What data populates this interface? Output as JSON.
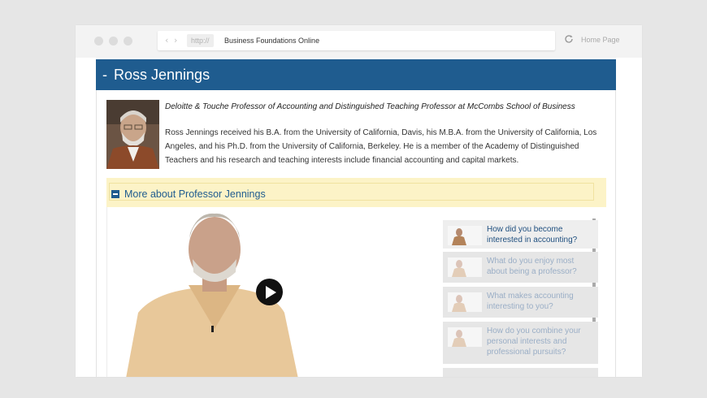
{
  "browser": {
    "url_protocol": "http://",
    "url_text": "Business Foundations Online",
    "home_link": "Home Page",
    "back_icon": "chevron-left-icon",
    "forward_icon": "chevron-right-icon",
    "reload_icon": "reload-icon"
  },
  "profile": {
    "collapse_symbol": "-",
    "name": "Ross Jennings",
    "title": "Deloitte & Touche Professor of Accounting and Distinguished Teaching Professor at McCombs School of Business",
    "bio": "Ross Jennings received his B.A. from the University of California, Davis, his M.B.A. from the University of California, Los Angeles, and his Ph.D. from the University of California, Berkeley. He is a member of the Academy of Distinguished Teachers and his research and teaching interests include financial accounting and capital markets."
  },
  "more": {
    "label": "More about Professor Jennings",
    "icon": "collapse-square-icon"
  },
  "video": {
    "play_icon": "play-icon"
  },
  "playlist": [
    {
      "label": "How did you become interested in accounting?",
      "active": true
    },
    {
      "label": "What do you enjoy most about being a professor?",
      "active": false
    },
    {
      "label": "What makes accounting interesting to you?",
      "active": false
    },
    {
      "label": "How do you combine your personal interests and professional pursuits?",
      "active": false
    }
  ],
  "colors": {
    "accent": "#1f5c8f",
    "highlight_bg": "#fcf3c7",
    "page_bg": "#e6e6e6"
  }
}
